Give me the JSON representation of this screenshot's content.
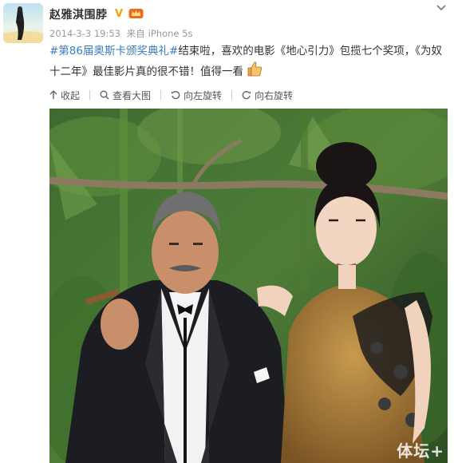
{
  "author": {
    "name": "赵雅淇围脖",
    "verified_badge": "V",
    "member_icon": "member-crown-icon"
  },
  "post": {
    "date": "2014-3-3 19:53",
    "source_prefix": "来自",
    "source": "iPhone 5s",
    "topic": "#第86届奥斯卡颁奖典礼#",
    "text": "结束啦，喜欢的电影《地心引力》包揽七个奖项，《为奴十二年》最佳影片真的很不错！值得一看"
  },
  "toolbar": {
    "collapse_label": "收起",
    "view_large_label": "查看大图",
    "rotate_left_label": "向左旋转",
    "rotate_right_label": "向右旋转"
  },
  "image": {
    "watermark": "体坛+"
  },
  "colors": {
    "link": "#3a7abf",
    "badge": "#f3a300",
    "meta": "#999999"
  }
}
